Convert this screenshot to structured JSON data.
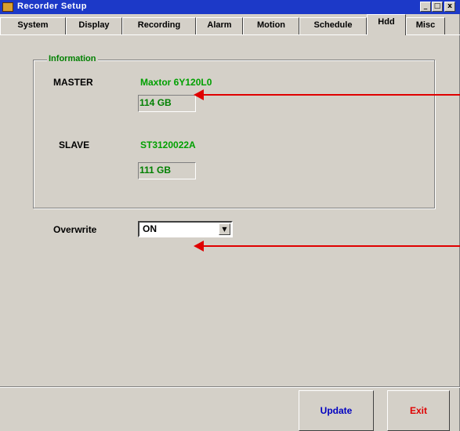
{
  "window": {
    "title": "Recorder Setup",
    "minimize_glyph": "_",
    "maximize_glyph": "□",
    "close_glyph": "x"
  },
  "tabs": [
    {
      "label": "System",
      "active": false
    },
    {
      "label": "Display",
      "active": false
    },
    {
      "label": "Recording",
      "active": false
    },
    {
      "label": "Alarm",
      "active": false
    },
    {
      "label": "Motion",
      "active": false
    },
    {
      "label": "Schedule",
      "active": false
    },
    {
      "label": "Hdd",
      "active": true
    },
    {
      "label": "Misc",
      "active": false
    }
  ],
  "information": {
    "group_label": "Information",
    "master": {
      "label": "MASTER",
      "model": "Maxtor 6Y120L0",
      "capacity": "114 GB"
    },
    "slave": {
      "label": "SLAVE",
      "model": "ST3120022A",
      "capacity": "111 GB"
    }
  },
  "overwrite": {
    "label": "Overwrite",
    "value": "ON",
    "dropdown_icon": "chevron-down-icon"
  },
  "buttons": {
    "update": "Update",
    "exit": "Exit"
  },
  "colors": {
    "arrow": "#e00000",
    "model_text": "#00a000",
    "titlebar": "#1c39c8"
  }
}
